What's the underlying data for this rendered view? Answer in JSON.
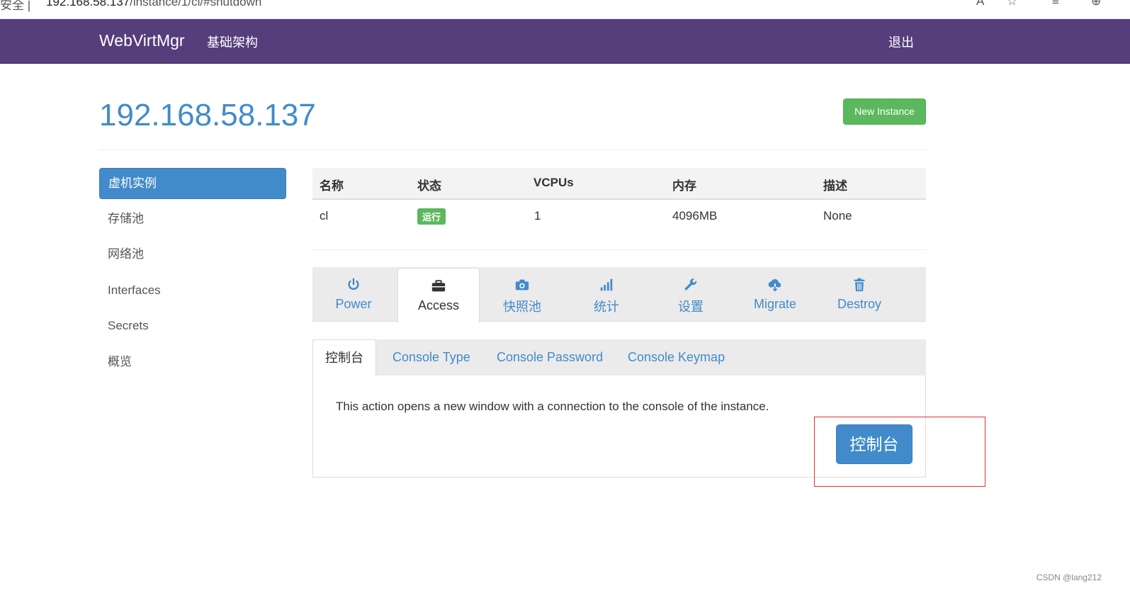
{
  "browser": {
    "secure_label": "安全",
    "separator": "|",
    "url_host": "192.168.58.137",
    "url_path": "/instance/1/cl/#shutdown",
    "icons": [
      "read-aloud-icon",
      "favorites-add-icon",
      "reading-list-icon",
      "collections-icon"
    ]
  },
  "navbar": {
    "brand": "WebVirtMgr",
    "infrastructure": "基础架构",
    "logout": "退出",
    "background": "#563d7c"
  },
  "header": {
    "title": "192.168.58.137",
    "new_instance": "New Instance"
  },
  "sidebar": {
    "items": [
      {
        "label": "虚机实例",
        "active": true
      },
      {
        "label": "存储池"
      },
      {
        "label": "网络池"
      },
      {
        "label": "Interfaces"
      },
      {
        "label": "Secrets"
      },
      {
        "label": "概览"
      }
    ]
  },
  "table": {
    "headers": [
      "名称",
      "状态",
      "VCPUs",
      "内存",
      "描述"
    ],
    "row": {
      "name": "cl",
      "status": "运行",
      "vcpus": "1",
      "memory": "4096MB",
      "description": "None"
    }
  },
  "tabs": [
    {
      "label": "Power",
      "icon": "power-icon"
    },
    {
      "label": "Access",
      "icon": "briefcase-icon",
      "active": true
    },
    {
      "label": "快照池",
      "icon": "camera-icon"
    },
    {
      "label": "统计",
      "icon": "signal-bars-icon"
    },
    {
      "label": "设置",
      "icon": "wrench-icon"
    },
    {
      "label": "Migrate",
      "icon": "cloud-download-icon"
    },
    {
      "label": "Destroy",
      "icon": "trash-icon"
    }
  ],
  "subtabs": [
    {
      "label": "控制台",
      "active": true
    },
    {
      "label": "Console Type"
    },
    {
      "label": "Console Password"
    },
    {
      "label": "Console Keymap"
    }
  ],
  "panel": {
    "text": "This action opens a new window with a connection to the console of the instance.",
    "button": "控制台"
  },
  "watermark": "CSDN @lang212",
  "colors": {
    "primary": "#428bca",
    "success": "#5cb85c",
    "highlight": "#e03030"
  }
}
